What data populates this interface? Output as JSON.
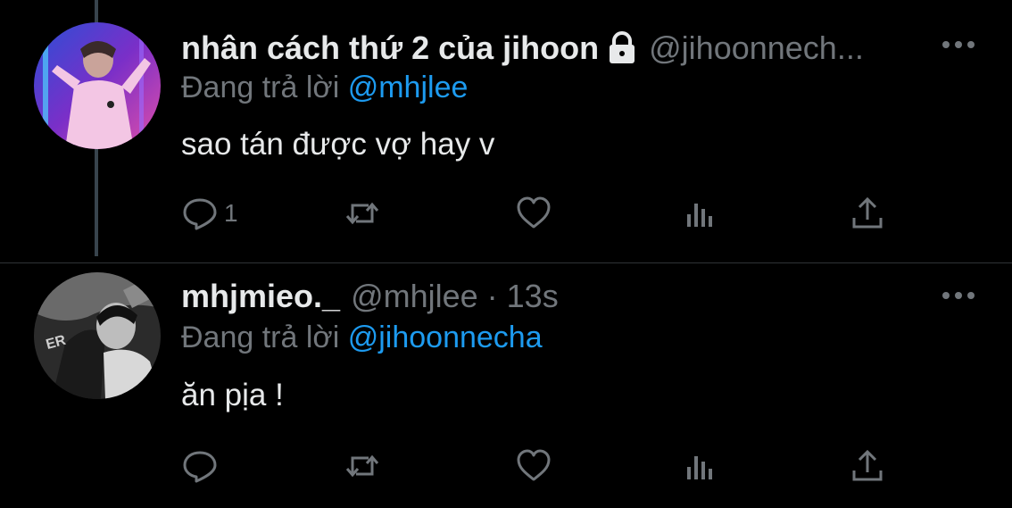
{
  "tweets": [
    {
      "display_name": "nhân cách thứ 2 của jihoon",
      "protected": true,
      "handle": "@jihoonnech...",
      "replying_prefix": "Đang trả lời",
      "replying_to": "@mhjlee",
      "text": "sao tán được vợ hay v",
      "actions": {
        "reply_count": "1",
        "retweet_count": "",
        "like_count": "",
        "view_count": ""
      }
    },
    {
      "display_name": "mhjmieo._",
      "protected": false,
      "handle": "@mhjlee",
      "separator": "·",
      "time": "13s",
      "replying_prefix": "Đang trả lời",
      "replying_to": "@jihoonnecha",
      "text": "ăn pịa !",
      "actions": {
        "reply_count": "",
        "retweet_count": "",
        "like_count": "",
        "view_count": ""
      }
    }
  ],
  "colors": {
    "background": "#000000",
    "text_primary": "#e7e9ea",
    "text_secondary": "#71767b",
    "accent": "#1d9bf0",
    "thread_line": "#38444d"
  },
  "icons": [
    "lock-icon",
    "more-icon",
    "reply-icon",
    "retweet-icon",
    "like-icon",
    "views-icon",
    "share-icon"
  ]
}
